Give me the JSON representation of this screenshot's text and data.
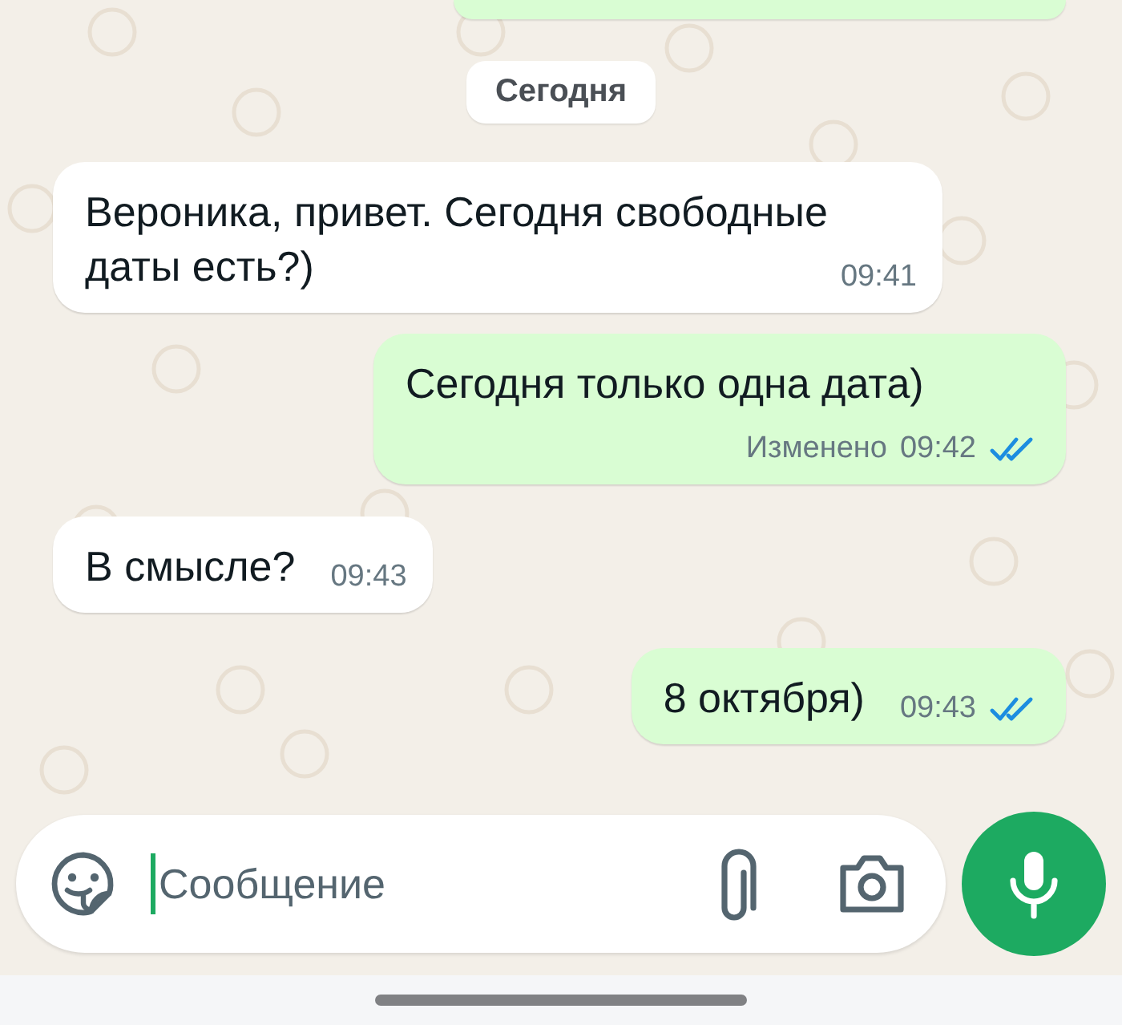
{
  "date_chip": "Сегодня",
  "messages": [
    {
      "kind": "incoming",
      "text": "Вероника, привет. Сегодня свободные даты есть?)",
      "time": "09:41"
    },
    {
      "kind": "outgoing",
      "text": "Сегодня только одна дата)",
      "edited_label": "Изменено",
      "time": "09:42",
      "read": true
    },
    {
      "kind": "incoming",
      "text": "В смысле?",
      "time": "09:43"
    },
    {
      "kind": "outgoing",
      "text": "8 октября)",
      "time": "09:43",
      "read": true
    }
  ],
  "composer": {
    "placeholder": "Сообщение"
  }
}
